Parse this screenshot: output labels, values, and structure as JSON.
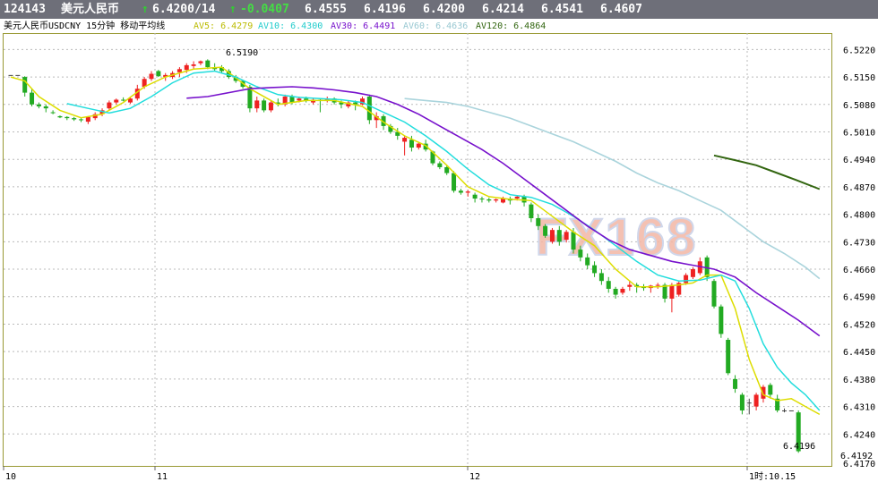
{
  "header": {
    "code": "124143",
    "name": "美元人民币",
    "price": "6.4200/14",
    "change": "-0.0407",
    "values": [
      "6.4555",
      "6.4196",
      "6.4200",
      "6.4214",
      "6.4541",
      "6.4607"
    ],
    "up_arrow": "↑"
  },
  "ma_bar": {
    "title": "美元人民币USDCNY 15分钟 移动平均线",
    "av5": "AV5: 6.4279",
    "av10": "AV10: 6.4300",
    "av30": "AV30: 6.4491",
    "av60": "AV60: 6.4636",
    "av120": "AV120: 6.4864"
  },
  "colors": {
    "bg": "#ffffff",
    "header_bg": "#6e6f79",
    "up": "#ee2222",
    "down": "#22aa22",
    "av5": "#dddd00",
    "av10": "#22dddd",
    "av30": "#7711cc",
    "av60": "#aad4dc",
    "av120": "#336611",
    "grid": "#bbbbbb",
    "frame": "#999933"
  },
  "watermark": "FX168",
  "chart_data": {
    "type": "candlestick",
    "ylim": [
      6.417,
      6.5255
    ],
    "y_ticks": [
      "6.5220",
      "6.5150",
      "6.5080",
      "6.5010",
      "6.4940",
      "6.4870",
      "6.4800",
      "6.4730",
      "6.4660",
      "6.4590",
      "6.4520",
      "6.4450",
      "6.4380",
      "6.4310",
      "6.4240",
      "6.4170"
    ],
    "x_ticks": [
      "10",
      "11",
      "12",
      "1时:10.15"
    ],
    "annotations": [
      "6.5190",
      "6.4196",
      "6.4192"
    ],
    "candles": [
      [
        6.5155,
        6.5155,
        6.5155,
        6.5155
      ],
      [
        6.5155,
        6.5155,
        6.5155,
        6.5155
      ],
      [
        6.515,
        6.5152,
        6.51,
        6.511
      ],
      [
        6.511,
        6.512,
        6.5075,
        6.508
      ],
      [
        6.508,
        6.5085,
        6.507,
        6.5075
      ],
      [
        6.5075,
        6.508,
        6.506,
        6.507
      ],
      [
        6.506,
        6.5065,
        6.5055,
        6.5058
      ],
      [
        6.505,
        6.5052,
        6.5045,
        6.5047
      ],
      [
        6.5048,
        6.505,
        6.504,
        6.5045
      ],
      [
        6.5045,
        6.5048,
        6.5038,
        6.5042
      ],
      [
        6.5042,
        6.5045,
        6.5035,
        6.504
      ],
      [
        6.5036,
        6.505,
        6.503,
        6.5048
      ],
      [
        6.5045,
        6.506,
        6.504,
        6.5055
      ],
      [
        6.5055,
        6.507,
        6.505,
        6.5065
      ],
      [
        6.507,
        6.509,
        6.5065,
        6.5085
      ],
      [
        6.5085,
        6.5095,
        6.508,
        6.5092
      ],
      [
        6.5092,
        6.5098,
        6.5088,
        6.509
      ],
      [
        6.5085,
        6.51,
        6.5082,
        6.5095
      ],
      [
        6.5095,
        6.513,
        6.509,
        6.512
      ],
      [
        6.5125,
        6.515,
        6.512,
        6.5145
      ],
      [
        6.5145,
        6.5165,
        6.514,
        6.5158
      ],
      [
        6.5165,
        6.5168,
        6.515,
        6.5152
      ],
      [
        6.515,
        6.516,
        6.514,
        6.5155
      ],
      [
        6.515,
        6.5165,
        6.5145,
        6.516
      ],
      [
        6.5162,
        6.5175,
        6.515,
        6.517
      ],
      [
        6.5168,
        6.5185,
        6.516,
        6.518
      ],
      [
        6.5178,
        6.519,
        6.517,
        6.5182
      ],
      [
        6.5185,
        6.5192,
        6.518,
        6.519
      ],
      [
        6.5192,
        6.5195,
        6.517,
        6.5175
      ],
      [
        6.5175,
        6.5185,
        6.5165,
        6.517
      ],
      [
        6.5175,
        6.518,
        6.516,
        6.5165
      ],
      [
        6.5165,
        6.517,
        6.5145,
        6.515
      ],
      [
        6.515,
        6.5155,
        6.5135,
        6.514
      ],
      [
        6.514,
        6.5142,
        6.512,
        6.5125
      ],
      [
        6.5125,
        6.513,
        6.506,
        6.507
      ],
      [
        6.507,
        6.51,
        6.506,
        6.509
      ],
      [
        6.509,
        6.5095,
        6.506,
        6.5065
      ],
      [
        6.5065,
        6.509,
        6.506,
        6.5085
      ],
      [
        6.5085,
        6.5095,
        6.5075,
        6.508
      ],
      [
        6.508,
        6.5105,
        6.5075,
        6.51
      ],
      [
        6.51,
        6.5105,
        6.508,
        6.5085
      ],
      [
        6.509,
        6.51,
        6.5085,
        6.5095
      ],
      [
        6.5095,
        6.51,
        6.5085,
        6.509
      ],
      [
        6.5085,
        6.5095,
        6.508,
        6.5092
      ],
      [
        6.5092,
        6.5095,
        6.506,
        6.509
      ],
      [
        6.509,
        6.51,
        6.5085,
        6.5095
      ],
      [
        6.5095,
        6.5098,
        6.508,
        6.5085
      ],
      [
        6.5085,
        6.509,
        6.507,
        6.508
      ],
      [
        6.5075,
        6.509,
        6.507,
        6.5085
      ],
      [
        6.5085,
        6.509,
        6.5065,
        6.508
      ],
      [
        6.508,
        6.51,
        6.5078,
        6.5095
      ],
      [
        6.51,
        6.5105,
        6.503,
        6.504
      ],
      [
        6.504,
        6.506,
        6.502,
        6.505
      ],
      [
        6.505,
        6.5055,
        6.5015,
        6.5025
      ],
      [
        6.5025,
        6.503,
        6.5005,
        6.501
      ],
      [
        6.501,
        6.502,
        6.499,
        6.5
      ],
      [
        6.4985,
        6.5,
        6.495,
        6.4995
      ],
      [
        6.499,
        6.5,
        6.496,
        6.497
      ],
      [
        6.497,
        6.4985,
        6.4965,
        6.498
      ],
      [
        6.498,
        6.499,
        6.496,
        6.4965
      ],
      [
        6.496,
        6.4962,
        6.4925,
        6.493
      ],
      [
        6.493,
        6.4935,
        6.4915,
        6.492
      ],
      [
        6.492,
        6.4925,
        6.49,
        6.4905
      ],
      [
        6.4905,
        6.491,
        6.4855,
        6.486
      ],
      [
        6.486,
        6.4865,
        6.485,
        6.4855
      ],
      [
        6.4855,
        6.4862,
        6.4845,
        6.4858
      ],
      [
        6.485,
        6.4855,
        6.483,
        6.484
      ],
      [
        6.484,
        6.4845,
        6.483,
        6.4838
      ],
      [
        6.4838,
        6.4842,
        6.483,
        6.4835
      ],
      [
        6.4835,
        6.484,
        6.483,
        6.4838
      ],
      [
        6.483,
        6.4845,
        6.4828,
        6.484
      ],
      [
        6.484,
        6.4845,
        6.4825,
        6.4835
      ],
      [
        6.484,
        6.4848,
        6.4835,
        6.4845
      ],
      [
        6.4845,
        6.485,
        6.482,
        6.483
      ],
      [
        6.4825,
        6.483,
        6.478,
        6.479
      ],
      [
        6.479,
        6.48,
        6.476,
        6.477
      ],
      [
        6.477,
        6.4775,
        6.474,
        6.4745
      ],
      [
        6.473,
        6.4765,
        6.4725,
        6.476
      ],
      [
        6.476,
        6.477,
        6.472,
        6.473
      ],
      [
        6.4735,
        6.476,
        6.4728,
        6.4755
      ],
      [
        6.4755,
        6.4765,
        6.47,
        6.471
      ],
      [
        6.471,
        6.472,
        6.468,
        6.469
      ],
      [
        6.469,
        6.47,
        6.466,
        6.467
      ],
      [
        6.467,
        6.468,
        6.464,
        6.465
      ],
      [
        6.465,
        6.466,
        6.462,
        6.463
      ],
      [
        6.463,
        6.464,
        6.46,
        6.461
      ],
      [
        6.461,
        6.4615,
        6.4585,
        6.4595
      ],
      [
        6.46,
        6.4615,
        6.4595,
        6.461
      ],
      [
        6.4615,
        6.463,
        6.4605,
        6.462
      ],
      [
        6.462,
        6.4625,
        6.46,
        6.4615
      ],
      [
        6.4615,
        6.4622,
        6.4605,
        6.4612
      ],
      [
        6.4612,
        6.462,
        6.46,
        6.4618
      ],
      [
        6.4618,
        6.4625,
        6.461,
        6.462
      ],
      [
        6.462,
        6.4625,
        6.4575,
        6.4585
      ],
      [
        6.4585,
        6.4625,
        6.455,
        6.462
      ],
      [
        6.4595,
        6.463,
        6.459,
        6.4625
      ],
      [
        6.4625,
        6.465,
        6.462,
        6.4645
      ],
      [
        6.464,
        6.4665,
        6.4635,
        6.466
      ],
      [
        6.465,
        6.469,
        6.4645,
        6.468
      ],
      [
        6.469,
        6.4695,
        6.463,
        6.464
      ],
      [
        6.463,
        6.4635,
        6.456,
        6.4565
      ],
      [
        6.4565,
        6.457,
        6.4485,
        6.4495
      ],
      [
        6.448,
        6.4485,
        6.439,
        6.4395
      ],
      [
        6.438,
        6.439,
        6.4345,
        6.4355
      ],
      [
        6.434,
        6.4345,
        6.429,
        6.43
      ],
      [
        6.432,
        6.433,
        6.429,
        6.432
      ],
      [
        6.431,
        6.4345,
        6.43,
        6.434
      ],
      [
        6.433,
        6.4365,
        6.432,
        6.436
      ],
      [
        6.4365,
        6.437,
        6.433,
        6.434
      ],
      [
        6.433,
        6.434,
        6.4295,
        6.43
      ],
      [
        6.43,
        6.4305,
        6.4295,
        6.43
      ],
      [
        6.43,
        6.43,
        6.43,
        6.43
      ],
      [
        6.4295,
        6.43,
        6.4192,
        6.4196
      ]
    ],
    "series": [
      {
        "name": "AV5",
        "values": [
          [
            0,
            6.515
          ],
          [
            2,
            6.514
          ],
          [
            4,
            6.51
          ],
          [
            7,
            6.5065
          ],
          [
            10,
            6.5046
          ],
          [
            13,
            6.5055
          ],
          [
            16,
            6.5085
          ],
          [
            19,
            6.5125
          ],
          [
            22,
            6.515
          ],
          [
            26,
            6.517
          ],
          [
            30,
            6.5175
          ],
          [
            34,
            6.512
          ],
          [
            38,
            6.508
          ],
          [
            42,
            6.509
          ],
          [
            46,
            6.509
          ],
          [
            50,
            6.5075
          ],
          [
            53,
            6.5035
          ],
          [
            56,
            6.5
          ],
          [
            59,
            6.4975
          ],
          [
            62,
            6.4925
          ],
          [
            65,
            6.487
          ],
          [
            68,
            6.4845
          ],
          [
            71,
            6.4838
          ],
          [
            74,
            6.4835
          ],
          [
            77,
            6.4795
          ],
          [
            80,
            6.4755
          ],
          [
            83,
            6.472
          ],
          [
            86,
            6.466
          ],
          [
            89,
            6.4615
          ],
          [
            92,
            6.4615
          ],
          [
            95,
            6.462
          ],
          [
            97,
            6.4625
          ],
          [
            99,
            6.4645
          ],
          [
            101,
            6.4645
          ],
          [
            103,
            6.456
          ],
          [
            105,
            6.443
          ],
          [
            107,
            6.434
          ],
          [
            109,
            6.4325
          ],
          [
            111,
            6.433
          ],
          [
            113,
            6.431
          ],
          [
            115,
            6.429
          ]
        ]
      },
      {
        "name": "AV10",
        "values": [
          [
            8,
            6.5082
          ],
          [
            11,
            6.507
          ],
          [
            14,
            6.5058
          ],
          [
            17,
            6.507
          ],
          [
            20,
            6.51
          ],
          [
            23,
            6.5135
          ],
          [
            26,
            6.516
          ],
          [
            29,
            6.5165
          ],
          [
            32,
            6.515
          ],
          [
            35,
            6.5125
          ],
          [
            38,
            6.5105
          ],
          [
            41,
            6.5098
          ],
          [
            44,
            6.5095
          ],
          [
            47,
            6.5092
          ],
          [
            50,
            6.5085
          ],
          [
            53,
            6.506
          ],
          [
            56,
            6.5035
          ],
          [
            59,
            6.5
          ],
          [
            62,
            6.496
          ],
          [
            65,
            6.4915
          ],
          [
            68,
            6.4875
          ],
          [
            71,
            6.485
          ],
          [
            74,
            6.4843
          ],
          [
            77,
            6.4825
          ],
          [
            80,
            6.4795
          ],
          [
            83,
            6.476
          ],
          [
            86,
            6.472
          ],
          [
            89,
            6.468
          ],
          [
            92,
            6.4645
          ],
          [
            95,
            6.463
          ],
          [
            98,
            6.4632
          ],
          [
            101,
            6.4645
          ],
          [
            103,
            6.463
          ],
          [
            105,
            6.456
          ],
          [
            107,
            6.447
          ],
          [
            109,
            6.441
          ],
          [
            111,
            6.437
          ],
          [
            113,
            6.434
          ],
          [
            115,
            6.43
          ]
        ]
      },
      {
        "name": "AV30",
        "values": [
          [
            25,
            6.5096
          ],
          [
            28,
            6.51
          ],
          [
            31,
            6.511
          ],
          [
            34,
            6.512
          ],
          [
            37,
            6.5123
          ],
          [
            40,
            6.5125
          ],
          [
            43,
            6.5122
          ],
          [
            46,
            6.5117
          ],
          [
            49,
            6.511
          ],
          [
            52,
            6.51
          ],
          [
            55,
            6.508
          ],
          [
            58,
            6.5055
          ],
          [
            61,
            6.5025
          ],
          [
            64,
            6.4995
          ],
          [
            67,
            6.4965
          ],
          [
            70,
            6.493
          ],
          [
            73,
            6.489
          ],
          [
            76,
            6.485
          ],
          [
            79,
            6.481
          ],
          [
            82,
            6.477
          ],
          [
            85,
            6.4735
          ],
          [
            88,
            6.471
          ],
          [
            91,
            6.4695
          ],
          [
            94,
            6.468
          ],
          [
            97,
            6.467
          ],
          [
            100,
            6.466
          ],
          [
            103,
            6.464
          ],
          [
            106,
            6.46
          ],
          [
            109,
            6.4565
          ],
          [
            112,
            6.453
          ],
          [
            115,
            6.449
          ]
        ]
      },
      {
        "name": "AV60",
        "values": [
          [
            56,
            6.5095
          ],
          [
            59,
            6.509
          ],
          [
            62,
            6.5085
          ],
          [
            65,
            6.5075
          ],
          [
            68,
            6.506
          ],
          [
            71,
            6.5045
          ],
          [
            74,
            6.5025
          ],
          [
            77,
            6.5005
          ],
          [
            80,
            6.4985
          ],
          [
            83,
            6.496
          ],
          [
            86,
            6.4935
          ],
          [
            89,
            6.4905
          ],
          [
            92,
            6.488
          ],
          [
            95,
            6.486
          ],
          [
            98,
            6.4835
          ],
          [
            101,
            6.481
          ],
          [
            104,
            6.477
          ],
          [
            107,
            6.473
          ],
          [
            110,
            6.47
          ],
          [
            113,
            6.4665
          ],
          [
            115,
            6.4636
          ]
        ]
      },
      {
        "name": "AV120",
        "values": [
          [
            100,
            6.495
          ],
          [
            103,
            6.4938
          ],
          [
            106,
            6.4925
          ],
          [
            109,
            6.4905
          ],
          [
            112,
            6.4885
          ],
          [
            115,
            6.4864
          ]
        ]
      }
    ]
  }
}
